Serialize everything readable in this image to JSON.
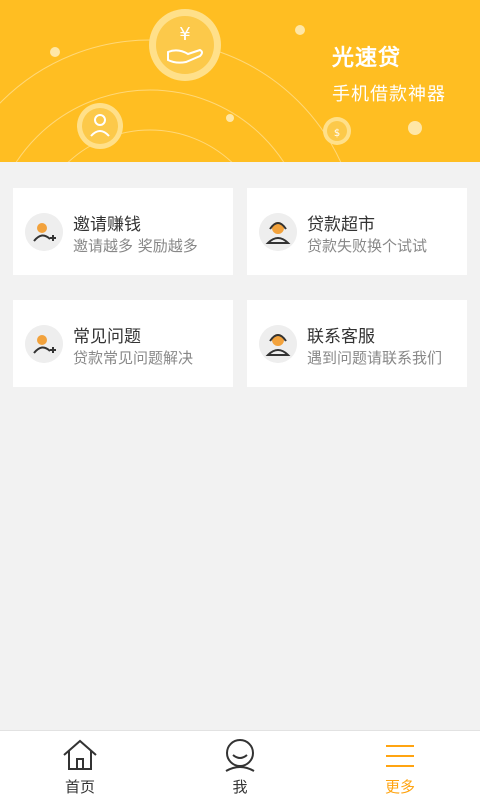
{
  "banner": {
    "title": "光速贷",
    "subtitle": "手机借款神器",
    "bg_color": "#ffbe22",
    "icons": [
      "money-hand-icon",
      "person-coin-icon",
      "coin-bag-icon"
    ]
  },
  "cards": [
    {
      "title": "邀请赚钱",
      "subtitle": "邀请越多  奖励越多",
      "icon": "user-add-icon"
    },
    {
      "title": "贷款超市",
      "subtitle": "贷款失败换个试试",
      "icon": "headset-agent-icon"
    },
    {
      "title": "常见问题",
      "subtitle": "贷款常见问题解决",
      "icon": "user-add-icon"
    },
    {
      "title": "联系客服",
      "subtitle": "遇到问题请联系我们",
      "icon": "headset-agent-icon"
    }
  ],
  "tabbar": {
    "items": [
      {
        "label": "首页",
        "icon": "home-icon",
        "active": false
      },
      {
        "label": "我",
        "icon": "user-icon",
        "active": false
      },
      {
        "label": "更多",
        "icon": "menu-icon",
        "active": true
      }
    ],
    "active_color": "#ffa411"
  }
}
